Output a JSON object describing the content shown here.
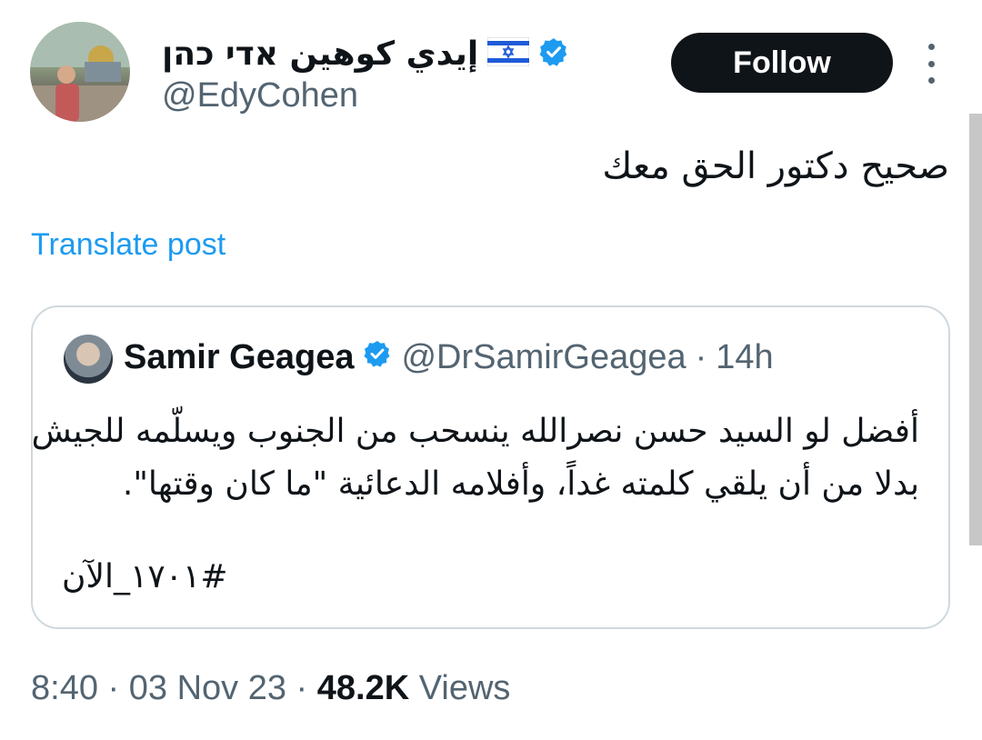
{
  "author": {
    "display_name": "إيدي كوهين אדי כהן",
    "handle": "@EdyCohen",
    "flag_icon": "israel-flag-icon",
    "verified_icon": "verified-badge-icon"
  },
  "follow_button": {
    "label": "Follow"
  },
  "more_icon": "more-vertical-icon",
  "tweet": {
    "text": "صحيح دكتور الحق معك",
    "translate_label": "Translate post"
  },
  "quoted": {
    "name": "Samir Geagea",
    "handle": "@DrSamirGeagea",
    "separator": "·",
    "time": "14h",
    "lines": [
      "أفضل لو السيد حسن نصرالله ينسحب من الجنوب ويسلّمه للجيش",
      "بدلا من أن يلقي كلمته غداً، وأفلامه الدعائية \"ما كان وقتها\"."
    ],
    "hashtag": "#١٧٠١_الآن"
  },
  "footer": {
    "time": "8:40",
    "sep1": "·",
    "date": "03 Nov 23",
    "sep2": "·",
    "views_count": "48.2K",
    "views_label": "Views"
  },
  "colors": {
    "accent": "#1d9bf0",
    "text": "#0f1419",
    "muted": "#536471",
    "border": "#cfd9de"
  }
}
